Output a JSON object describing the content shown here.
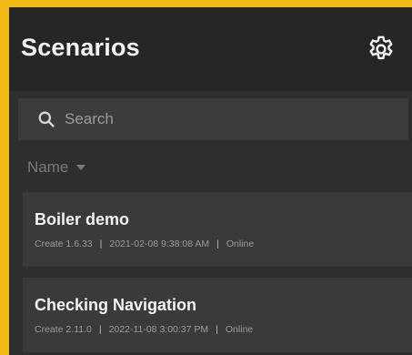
{
  "header": {
    "title": "Scenarios",
    "settings_icon": "gear-icon"
  },
  "search": {
    "placeholder": "Search",
    "icon": "search-icon"
  },
  "sort": {
    "label": "Name",
    "icon": "caret-down-icon"
  },
  "scenarios": [
    {
      "name": "Boiler demo",
      "version": "Create 1.6.33",
      "datetime": "2021-02-08 9:38:08 AM",
      "status": "Online"
    },
    {
      "name": "Checking Navigation",
      "version": "Create 2.11.0",
      "datetime": "2022-11-08 3:00:37 PM",
      "status": "Online"
    }
  ],
  "colors": {
    "frame": "#F2B814",
    "background": "#2E2E2E",
    "header": "#262626",
    "card": "#3A3A3A"
  }
}
